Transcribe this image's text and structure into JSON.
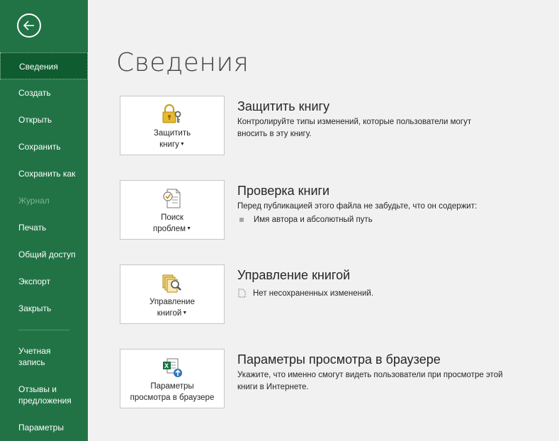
{
  "sidebar": {
    "items": [
      {
        "label": "Сведения"
      },
      {
        "label": "Создать"
      },
      {
        "label": "Открыть"
      },
      {
        "label": "Сохранить"
      },
      {
        "label": "Сохранить как"
      },
      {
        "label": "Журнал"
      },
      {
        "label": "Печать"
      },
      {
        "label": "Общий доступ"
      },
      {
        "label": "Экспорт"
      },
      {
        "label": "Закрыть"
      },
      {
        "label_l1": "Учетная",
        "label_l2": "запись"
      },
      {
        "label_l1": "Отзывы и",
        "label_l2": "предложения"
      },
      {
        "label": "Параметры"
      }
    ],
    "colors": {
      "background": "#217346",
      "active": "#0e5c2f",
      "disabled_text": "#7fb495"
    }
  },
  "page": {
    "title": "Сведения"
  },
  "sections": [
    {
      "button_line1": "Защитить",
      "button_line2": "книгу",
      "icon": "lock-key-icon",
      "title": "Защитить книгу",
      "desc_line1": "Контролируйте типы изменений, которые пользователи могут",
      "desc_line2": "вносить в эту книгу."
    },
    {
      "button_line1": "Поиск",
      "button_line2": "проблем",
      "icon": "inspect-document-icon",
      "title": "Проверка книги",
      "desc_line1": "Перед публикацией этого файла не забудьте, что он содержит:",
      "bullet": "Имя автора и абсолютный путь"
    },
    {
      "button_line1": "Управление",
      "button_line2": "книгой",
      "icon": "manage-workbook-icon",
      "title": "Управление книгой",
      "status": "Нет несохраненных изменений."
    },
    {
      "button_line1": "Параметры",
      "button_line2": "просмотра в браузере",
      "icon": "browser-view-options-icon",
      "title": "Параметры просмотра в браузере",
      "desc_line1": "Укажите, что именно смогут видеть пользователи при просмотре этой",
      "desc_line2": "книги в Интернете."
    }
  ]
}
